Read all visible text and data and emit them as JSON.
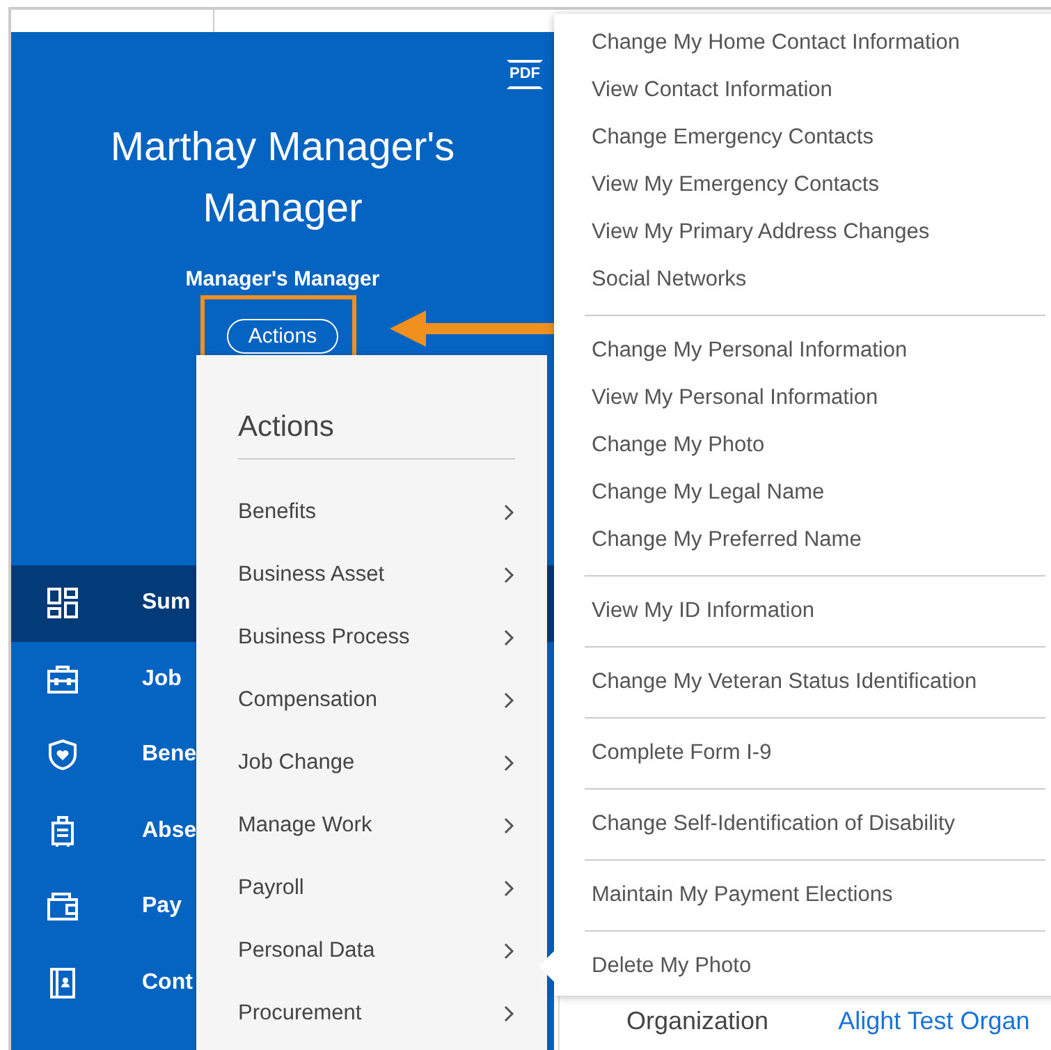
{
  "profile": {
    "name_lines": [
      "Marthay Manager's",
      "Manager"
    ],
    "subtitle": "Manager's Manager",
    "actions_button": "Actions",
    "pdf_label": "PDF"
  },
  "nav": [
    {
      "label": "Sum",
      "selected": true
    },
    {
      "label": "Job",
      "selected": false
    },
    {
      "label": "Bene",
      "selected": false
    },
    {
      "label": "Abse",
      "selected": false
    },
    {
      "label": "Pay",
      "selected": false
    },
    {
      "label": "Cont",
      "selected": false
    }
  ],
  "actions_menu": {
    "title": "Actions",
    "items": [
      "Benefits",
      "Business Asset",
      "Business Process",
      "Compensation",
      "Job Change",
      "Manage Work",
      "Payroll",
      "Personal Data",
      "Procurement"
    ]
  },
  "submenu": {
    "groups": [
      [
        "Change My Home Contact Information",
        "View Contact Information",
        "Change Emergency Contacts",
        "View My Emergency Contacts",
        "View My Primary Address Changes",
        "Social Networks"
      ],
      [
        "Change My Personal Information",
        "View My Personal Information",
        "Change My Photo",
        "Change My Legal Name",
        "Change My Preferred Name"
      ],
      [
        "View My ID Information"
      ],
      [
        "Change My Veteran Status Identification"
      ],
      [
        "Complete Form I-9"
      ],
      [
        "Change Self-Identification of Disability"
      ],
      [
        "Maintain My Payment Elections"
      ],
      [
        "Delete My Photo"
      ]
    ]
  },
  "field": {
    "label": "Organization",
    "value": "Alight Test Organ"
  }
}
